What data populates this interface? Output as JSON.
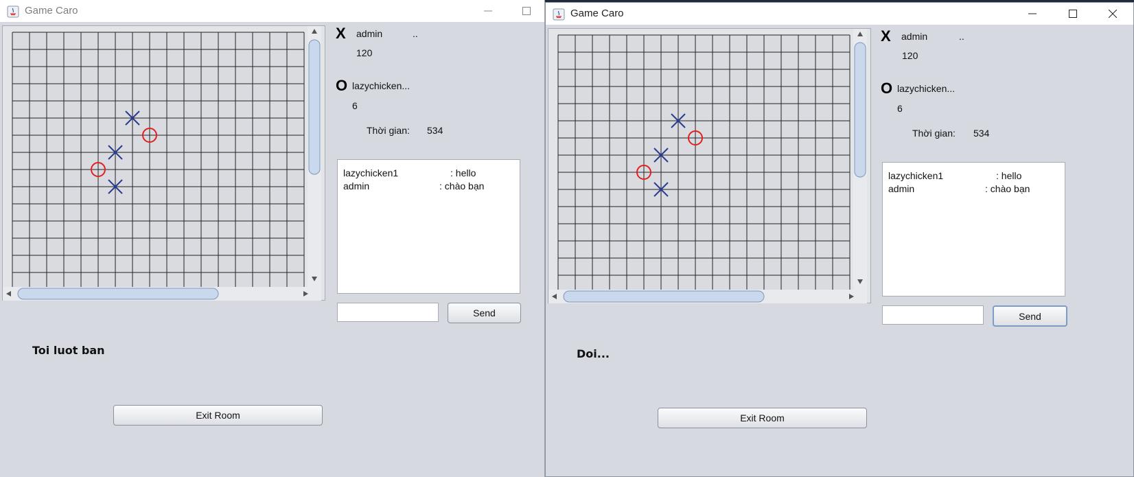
{
  "windows": [
    {
      "id": "left",
      "title": "Game Caro",
      "player_x": {
        "mark": "X",
        "name": "admin",
        "extra": "..",
        "score": "120"
      },
      "player_o": {
        "mark": "O",
        "name": "lazychicken...",
        "score": "6"
      },
      "timer": {
        "label": "Thời gian:",
        "value": "534"
      },
      "chat": [
        {
          "user": "lazychicken1",
          "msg": ": hello"
        },
        {
          "user": "admin",
          "msg": ": chào bạn"
        }
      ],
      "send_label": "Send",
      "status": "Toi luot ban",
      "exit_label": "Exit Room"
    },
    {
      "id": "right",
      "title": "Game Caro",
      "player_x": {
        "mark": "X",
        "name": "admin",
        "extra": "..",
        "score": "120"
      },
      "player_o": {
        "mark": "O",
        "name": "lazychicken...",
        "score": "6"
      },
      "timer": {
        "label": "Thời gian:",
        "value": "534"
      },
      "chat": [
        {
          "user": "lazychicken1",
          "msg": ": hello"
        },
        {
          "user": "admin",
          "msg": ": chào bạn"
        }
      ],
      "send_label": "Send",
      "status": "Doi...",
      "exit_label": "Exit Room"
    }
  ],
  "board": {
    "moves": [
      {
        "mark": "X",
        "row": 5,
        "col": 7
      },
      {
        "mark": "O",
        "row": 6,
        "col": 8
      },
      {
        "mark": "X",
        "row": 7,
        "col": 6
      },
      {
        "mark": "O",
        "row": 8,
        "col": 5
      },
      {
        "mark": "X",
        "row": 9,
        "col": 6
      }
    ],
    "x_color": "#2b3d8f",
    "o_color": "#e02020",
    "line_color": "#222222"
  }
}
